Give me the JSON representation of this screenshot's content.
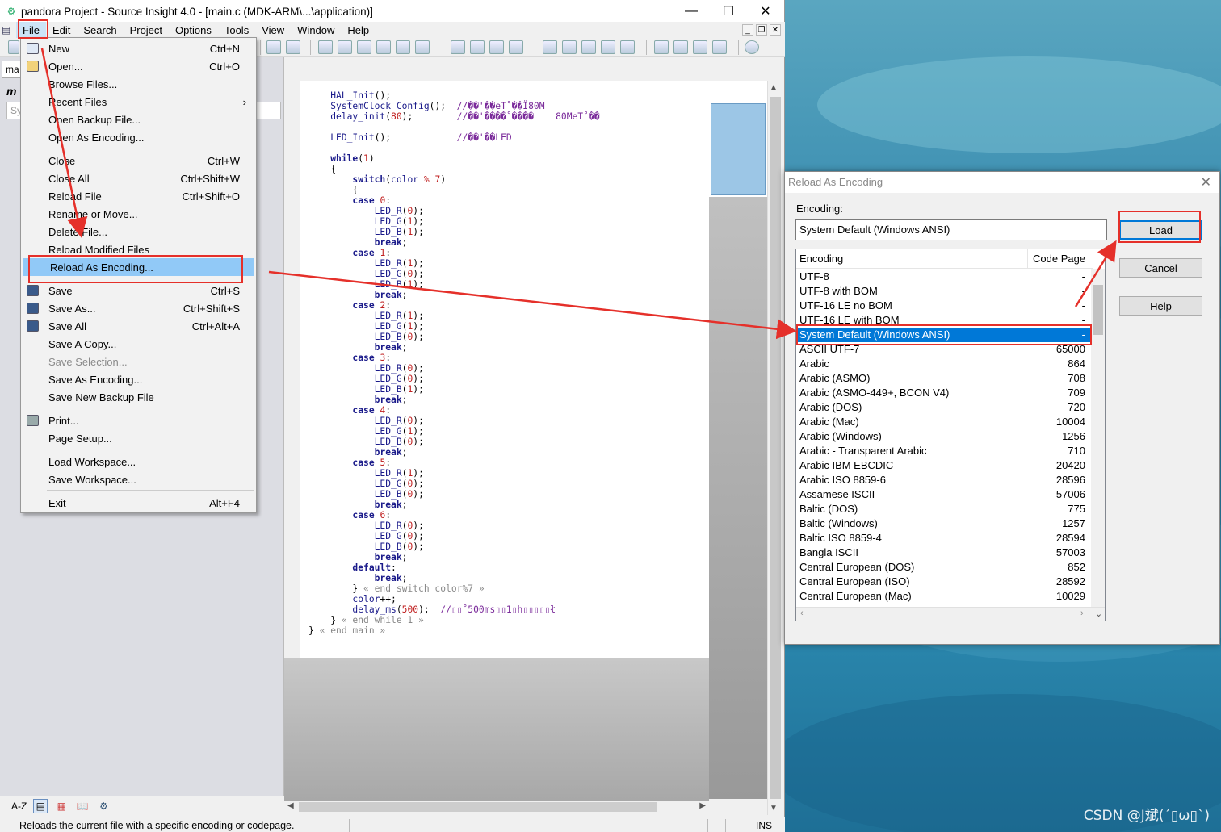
{
  "window": {
    "title": "pandora Project - Source Insight 4.0 - [main.c (MDK-ARM\\...\\application)]",
    "minimize": "—",
    "maximize": "☐",
    "close": "✕"
  },
  "menubar": [
    "File",
    "Edit",
    "Search",
    "Project",
    "Options",
    "Tools",
    "View",
    "Window",
    "Help"
  ],
  "leftpane": {
    "tab_label": "ma",
    "header": "m",
    "symbol_placeholder": "Sy"
  },
  "file_menu": {
    "items": [
      {
        "label": "New",
        "shortcut": "Ctrl+N",
        "icon": "new-file-icon"
      },
      {
        "label": "Open...",
        "shortcut": "Ctrl+O",
        "icon": "open-folder-icon"
      },
      {
        "label": "Browse Files...",
        "shortcut": ""
      },
      {
        "label": "Recent Files",
        "shortcut": "",
        "submenu_glyph": "›"
      },
      {
        "label": "Open Backup File...",
        "shortcut": ""
      },
      {
        "label": "Open As Encoding...",
        "shortcut": ""
      },
      {
        "label": "Close",
        "shortcut": "Ctrl+W"
      },
      {
        "label": "Close All",
        "shortcut": "Ctrl+Shift+W"
      },
      {
        "label": "Reload File",
        "shortcut": "Ctrl+Shift+O"
      },
      {
        "label": "Rename or Move...",
        "shortcut": ""
      },
      {
        "label": "Delete File...",
        "shortcut": ""
      },
      {
        "label": "Reload Modified Files",
        "shortcut": ""
      },
      {
        "label": "Reload As Encoding...",
        "shortcut": "",
        "highlighted": true
      },
      {
        "label": "Save",
        "shortcut": "Ctrl+S",
        "icon": "save-icon"
      },
      {
        "label": "Save As...",
        "shortcut": "Ctrl+Shift+S",
        "icon": "save-as-icon"
      },
      {
        "label": "Save All",
        "shortcut": "Ctrl+Alt+A",
        "icon": "save-all-icon"
      },
      {
        "label": "Save A Copy...",
        "shortcut": ""
      },
      {
        "label": "Save Selection...",
        "shortcut": "",
        "disabled": true
      },
      {
        "label": "Save As Encoding...",
        "shortcut": ""
      },
      {
        "label": "Save New Backup File",
        "shortcut": ""
      },
      {
        "label": "Print...",
        "shortcut": "",
        "icon": "printer-icon"
      },
      {
        "label": "Page Setup...",
        "shortcut": ""
      },
      {
        "label": "Load Workspace...",
        "shortcut": ""
      },
      {
        "label": "Save Workspace...",
        "shortcut": ""
      },
      {
        "label": "Exit",
        "shortcut": "Alt+F4"
      }
    ]
  },
  "code_lines": [
    "    HAL_Init();",
    "    SystemClock_Config();  //��'��еT˚��Ï80M",
    "    delay_init(80);        //��'����˚����    80MеT˚��",
    "",
    "    LED_Init();            //��'��LED",
    "",
    "    while(1)",
    "    {",
    "        switch(color % 7)",
    "        {",
    "        case 0:",
    "            LED_R(0);",
    "            LED_G(1);",
    "            LED_B(1);",
    "            break;",
    "        case 1:",
    "            LED_R(1);",
    "            LED_G(0);",
    "            LED_B(1);",
    "            break;",
    "        case 2:",
    "            LED_R(1);",
    "            LED_G(1);",
    "            LED_B(0);",
    "            break;",
    "        case 3:",
    "            LED_R(0);",
    "            LED_G(0);",
    "            LED_B(1);",
    "            break;",
    "        case 4:",
    "            LED_R(0);",
    "            LED_G(1);",
    "            LED_B(0);",
    "            break;",
    "        case 5:",
    "            LED_R(1);",
    "            LED_G(0);",
    "            LED_B(0);",
    "            break;",
    "        case 6:",
    "            LED_R(0);",
    "            LED_G(0);",
    "            LED_B(0);",
    "            break;",
    "        default:",
    "            break;",
    "        } « end switch color%7 »",
    "        color++;",
    "        delay_ms(500);  //▯▯˚500ms▯▯1▯h▯▯▯▯▯ł",
    "    } « end while 1 »",
    "} « end main »"
  ],
  "statusbar": {
    "message": "Reloads the current file with a specific encoding or codepage.",
    "mode": "INS"
  },
  "dialog": {
    "title": "Reload As Encoding",
    "close": "✕",
    "encoding_label": "Encoding:",
    "encoding_value": "System Default (Windows ANSI)",
    "buttons": {
      "load": "Load",
      "cancel": "Cancel",
      "help": "Help"
    },
    "columns": {
      "encoding": "Encoding",
      "code_page": "Code Page"
    },
    "rows": [
      {
        "name": "UTF-8",
        "cp": "-"
      },
      {
        "name": "UTF-8 with BOM",
        "cp": "-"
      },
      {
        "name": "UTF-16 LE no BOM",
        "cp": "-"
      },
      {
        "name": "UTF-16 LE with BOM",
        "cp": "-"
      },
      {
        "name": "System Default (Windows ANSI)",
        "cp": "-",
        "selected": true
      },
      {
        "name": "ASCII UTF-7",
        "cp": "65000"
      },
      {
        "name": "Arabic",
        "cp": "864"
      },
      {
        "name": "Arabic (ASMO)",
        "cp": "708"
      },
      {
        "name": "Arabic (ASMO-449+, BCON V4)",
        "cp": "709"
      },
      {
        "name": "Arabic (DOS)",
        "cp": "720"
      },
      {
        "name": "Arabic (Mac)",
        "cp": "10004"
      },
      {
        "name": "Arabic (Windows)",
        "cp": "1256"
      },
      {
        "name": "Arabic - Transparent Arabic",
        "cp": "710"
      },
      {
        "name": "Arabic IBM EBCDIC",
        "cp": "20420"
      },
      {
        "name": "Arabic ISO 8859-6",
        "cp": "28596"
      },
      {
        "name": "Assamese ISCII",
        "cp": "57006"
      },
      {
        "name": "Baltic (DOS)",
        "cp": "775"
      },
      {
        "name": "Baltic (Windows)",
        "cp": "1257"
      },
      {
        "name": "Baltic ISO 8859-4",
        "cp": "28594"
      },
      {
        "name": "Bangla ISCII",
        "cp": "57003"
      },
      {
        "name": "Central European (DOS)",
        "cp": "852"
      },
      {
        "name": "Central European (ISO)",
        "cp": "28592"
      },
      {
        "name": "Central European (Mac)",
        "cp": "10029"
      }
    ]
  },
  "watermark": "CSDN @J斌(´▯ω▯`)",
  "colors": {
    "annotation_red": "#e5302a",
    "selection_blue": "#0078d7",
    "menu_highlight": "#91c9f7"
  }
}
